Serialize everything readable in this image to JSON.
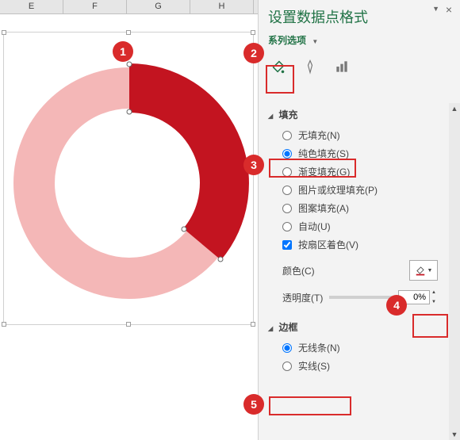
{
  "columns": [
    "E",
    "F",
    "G",
    "H"
  ],
  "pane": {
    "title": "设置数据点格式",
    "series_label": "系列选项"
  },
  "fill": {
    "section": "填充",
    "none": "无填充(N)",
    "solid": "纯色填充(S)",
    "gradient": "渐变填充(G)",
    "picture": "图片或纹理填充(P)",
    "pattern": "图案填充(A)",
    "auto": "自动(U)",
    "vary": "按扇区着色(V)",
    "color_label": "颜色(C)",
    "trans_label": "透明度(T)",
    "trans_value": "0%"
  },
  "border": {
    "section": "边框",
    "none": "无线条(N)",
    "solid": "实线(S)"
  },
  "callouts": {
    "c1": "1",
    "c2": "2",
    "c3": "3",
    "c4": "4",
    "c5": "5"
  },
  "chart_data": {
    "type": "doughnut",
    "series": [
      {
        "name": "selected-arc",
        "start_deg": 0,
        "end_deg": 130,
        "color": "#c31420"
      },
      {
        "name": "background-arc",
        "start_deg": 130,
        "end_deg": 360,
        "color": "#f4b7b7"
      }
    ],
    "inner_radius_pct": 55,
    "center": [
      162,
      210
    ]
  }
}
